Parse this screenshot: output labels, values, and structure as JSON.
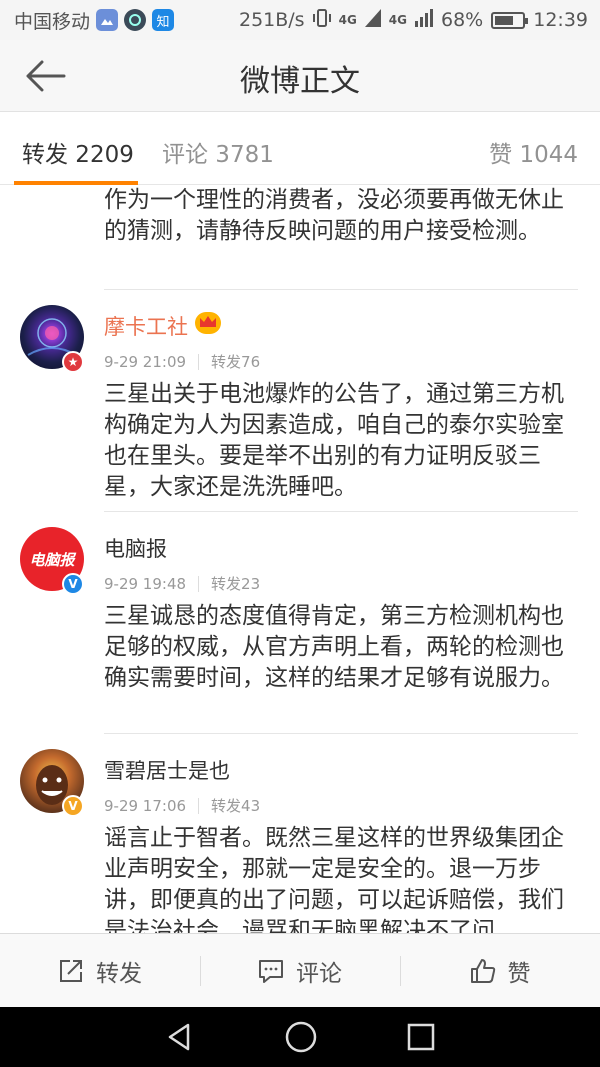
{
  "status_bar": {
    "carrier": "中国移动",
    "app_icon_zhihu": "知",
    "net_speed": "251B/s",
    "network_1": "4G",
    "network_2": "4G",
    "battery": "68%",
    "battery_level": 0.68,
    "time": "12:39"
  },
  "header": {
    "title": "微博正文"
  },
  "tabs": {
    "repost": "转发 2209",
    "comment": "评论 3781",
    "like": "赞 1044",
    "accent": "#ff8200"
  },
  "feed": {
    "truncated_text": "作为一个理性的消费者，没必须要再做无休止的猜测，请静待反映问题的用户接受检测。",
    "items": [
      {
        "name": "摩卡工社",
        "time": "9-29 21:09",
        "reposts": "转发76",
        "text": "三星出关于电池爆炸的公告了，通过第三方机构确定为人为因素造成，咱自己的泰尔实验室也在里头。要是举不出别的有力证明反驳三星，大家还是洗洗睡吧。"
      },
      {
        "name": "电脑报",
        "avatar_text": "电脑报",
        "time": "9-29 19:48",
        "reposts": "转发23",
        "text": "三星诚恳的态度值得肯定，第三方检测机构也足够的权威，从官方声明上看，两轮的检测也确实需要时间，这样的结果才足够有说服力。"
      },
      {
        "name": "雪碧居士是也",
        "time": "9-29 17:06",
        "reposts": "转发43",
        "text": "谣言止于智者。既然三星这样的世界级集团企业声明安全，那就一定是安全的。退一万步讲，即便真的出了问题，可以起诉赔偿，我们是法治社会，谩骂和无脑黑解决不了问"
      }
    ]
  },
  "action_bar": {
    "repost": "转发",
    "comment": "评论",
    "like": "赞"
  }
}
